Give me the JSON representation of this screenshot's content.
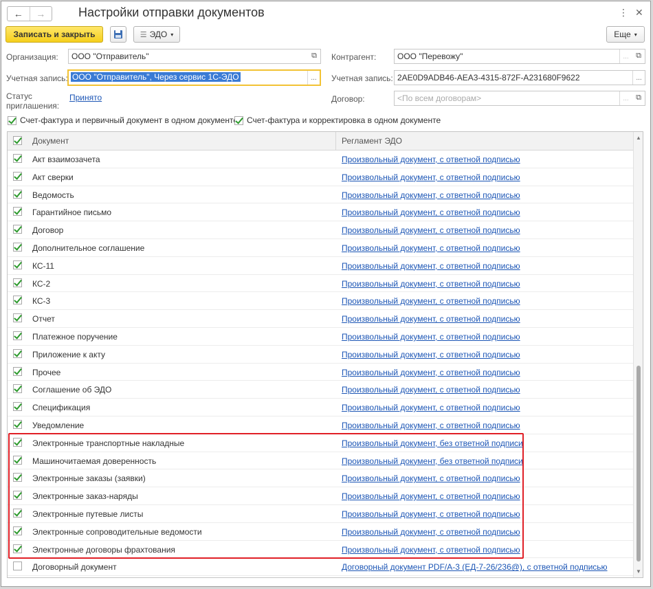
{
  "window": {
    "title": "Настройки отправки документов",
    "nav_back": "←",
    "nav_forward": "→",
    "kebab_icon": "⋮",
    "close_icon": "✕"
  },
  "toolbar": {
    "save_close_label": "Записать и закрыть",
    "save_icon": "floppy-disk-icon",
    "edo_label": "ЭДО",
    "more_label": "Еще"
  },
  "form": {
    "organization_label": "Организация:",
    "organization_value": "ООО \"Отправитель\"",
    "account_label_left": "Учетная запись:",
    "account_value_left": "ООО \"Отправитель\", Через сервис 1С-ЭДО",
    "invitation_status_label": "Статус приглашения:",
    "invitation_status_value": "Принято",
    "counterparty_label": "Контрагент:",
    "counterparty_value": "ООО \"Перевожу\"",
    "account_label_right": "Учетная запись:",
    "account_value_right": "2AE0D9ADB46-AEA3-4315-872F-A231680F9622",
    "contract_label": "Договор:",
    "contract_placeholder": "<По всем договорам>",
    "ellipsis": "...",
    "open_icon": "⧉"
  },
  "options": {
    "opt1_label": "Счет-фактура и первичный документ в одном документе",
    "opt1_checked": true,
    "opt2_label": "Счет-фактура и корректировка в одном документе",
    "opt2_checked": true
  },
  "table": {
    "col_document": "Документ",
    "col_regulation": "Регламент ЭДО",
    "rows": [
      {
        "doc": "Акт взаимозачета",
        "reg": "Произвольный документ, с ответной подписью",
        "checked": true
      },
      {
        "doc": "Акт сверки",
        "reg": "Произвольный документ, с ответной подписью",
        "checked": true
      },
      {
        "doc": "Ведомость",
        "reg": "Произвольный документ, с ответной подписью",
        "checked": true
      },
      {
        "doc": "Гарантийное письмо",
        "reg": "Произвольный документ, с ответной подписью",
        "checked": true
      },
      {
        "doc": "Договор",
        "reg": "Произвольный документ, с ответной подписью",
        "checked": true
      },
      {
        "doc": "Дополнительное соглашение",
        "reg": "Произвольный документ, с ответной подписью",
        "checked": true
      },
      {
        "doc": "КС-11",
        "reg": "Произвольный документ, с ответной подписью",
        "checked": true
      },
      {
        "doc": "КС-2",
        "reg": "Произвольный документ, с ответной подписью",
        "checked": true
      },
      {
        "doc": "КС-3",
        "reg": "Произвольный документ, с ответной подписью",
        "checked": true
      },
      {
        "doc": "Отчет",
        "reg": "Произвольный документ, с ответной подписью",
        "checked": true
      },
      {
        "doc": "Платежное поручение",
        "reg": "Произвольный документ, с ответной подписью",
        "checked": true
      },
      {
        "doc": "Приложение к акту",
        "reg": "Произвольный документ, с ответной подписью",
        "checked": true
      },
      {
        "doc": "Прочее",
        "reg": "Произвольный документ, с ответной подписью",
        "checked": true
      },
      {
        "doc": "Соглашение об ЭДО",
        "reg": "Произвольный документ, с ответной подписью",
        "checked": true
      },
      {
        "doc": "Спецификация",
        "reg": "Произвольный документ, с ответной подписью",
        "checked": true
      },
      {
        "doc": "Уведомление",
        "reg": "Произвольный документ, с ответной подписью",
        "checked": true
      },
      {
        "doc": "Электронные транспортные накладные",
        "reg": "Произвольный документ, без ответной подписи",
        "checked": true
      },
      {
        "doc": "Машиночитаемая доверенность",
        "reg": "Произвольный документ, без ответной подписи",
        "checked": true
      },
      {
        "doc": "Электронные заказы (заявки)",
        "reg": "Произвольный документ, с ответной подписью",
        "checked": true
      },
      {
        "doc": "Электронные заказ-наряды",
        "reg": "Произвольный документ, с ответной подписью",
        "checked": true
      },
      {
        "doc": "Электронные путевые листы",
        "reg": "Произвольный документ, с ответной подписью",
        "checked": true
      },
      {
        "doc": "Электронные сопроводительные ведомости",
        "reg": "Произвольный документ, с ответной подписью",
        "checked": true
      },
      {
        "doc": "Электронные договоры фрахтования",
        "reg": "Произвольный документ, с ответной подписью",
        "checked": true
      },
      {
        "doc": "Договорный документ",
        "reg": "Договорный документ PDF/A-3 (ЕД-7-26/236@), с ответной подписью",
        "checked": false
      }
    ]
  },
  "colors": {
    "primary_button": "#f5cf1c",
    "focus_border": "#f2c233",
    "link": "#1b55b5",
    "check": "#2d9a2d",
    "highlight_frame": "#e01f26"
  }
}
